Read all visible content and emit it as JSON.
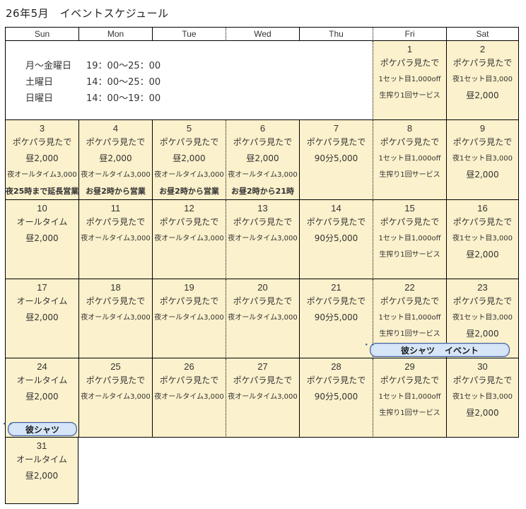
{
  "title": "26年5月　イベントスケジュール",
  "weekdays": [
    "Sun",
    "Mon",
    "Tue",
    "Wed",
    "Thu",
    "Fri",
    "Sat"
  ],
  "hours": [
    {
      "label": "月～金曜日",
      "time": "19：00～25：00"
    },
    {
      "label": "土曜日",
      "time": "14：00～25：00"
    },
    {
      "label": "日曜日",
      "time": "14：00～19：00"
    }
  ],
  "days": [
    {
      "n": "1",
      "lines": [
        "ポケパラ見たで",
        "1セット目1,000off",
        "生搾り1回サービス"
      ]
    },
    {
      "n": "2",
      "lines": [
        "ポケパラ見たで",
        "夜1セット目3,000",
        "昼2,000"
      ]
    },
    {
      "n": "3",
      "lines": [
        "ポケパラ見たで",
        "昼2,000",
        "夜オールタイム3,000",
        "夜25時まで延長営業"
      ]
    },
    {
      "n": "4",
      "lines": [
        "ポケパラ見たで",
        "昼2,000",
        "夜オールタイム3,000",
        "お昼2時から営業"
      ]
    },
    {
      "n": "5",
      "lines": [
        "ポケパラ見たで",
        "昼2,000",
        "夜オールタイム3,000",
        "お昼2時から営業"
      ]
    },
    {
      "n": "6",
      "lines": [
        "ポケパラ見たで",
        "昼2,000",
        "夜オールタイム3,000",
        "お昼2時から21時"
      ]
    },
    {
      "n": "7",
      "lines": [
        "ポケパラ見たで",
        "90分5,000"
      ]
    },
    {
      "n": "8",
      "lines": [
        "ポケパラ見たで",
        "1セット目1,000off",
        "生搾り1回サービス"
      ]
    },
    {
      "n": "9",
      "lines": [
        "ポケパラ見たで",
        "夜1セット目3,000",
        "昼2,000"
      ]
    },
    {
      "n": "10",
      "lines": [
        "オールタイム",
        "昼2,000"
      ]
    },
    {
      "n": "11",
      "lines": [
        "ポケパラ見たで",
        "夜オールタイム3,000"
      ]
    },
    {
      "n": "12",
      "lines": [
        "ポケパラ見たで",
        "夜オールタイム3,000"
      ]
    },
    {
      "n": "13",
      "lines": [
        "ポケパラ見たで",
        "夜オールタイム3,000"
      ]
    },
    {
      "n": "14",
      "lines": [
        "ポケパラ見たで",
        "90分5,000"
      ]
    },
    {
      "n": "15",
      "lines": [
        "ポケパラ見たで",
        "1セット目1,000off",
        "生搾り1回サービス"
      ]
    },
    {
      "n": "16",
      "lines": [
        "ポケパラ見たで",
        "夜1セット目3,000",
        "昼2,000"
      ]
    },
    {
      "n": "17",
      "lines": [
        "オールタイム",
        "昼2,000"
      ]
    },
    {
      "n": "18",
      "lines": [
        "ポケパラ見たで",
        "夜オールタイム3,000"
      ]
    },
    {
      "n": "19",
      "lines": [
        "ポケパラ見たで",
        "夜オールタイム3,000"
      ]
    },
    {
      "n": "20",
      "lines": [
        "ポケパラ見たで",
        "夜オールタイム3,000"
      ]
    },
    {
      "n": "21",
      "lines": [
        "ポケパラ見たで",
        "90分5,000"
      ]
    },
    {
      "n": "22",
      "lines": [
        "ポケパラ見たで",
        "1セット目1,000off",
        "生搾り1回サービス"
      ]
    },
    {
      "n": "23",
      "lines": [
        "ポケパラ見たで",
        "夜1セット目3,000",
        "昼2,000"
      ]
    },
    {
      "n": "24",
      "lines": [
        "オールタイム",
        "昼2,000"
      ]
    },
    {
      "n": "25",
      "lines": [
        "ポケパラ見たで",
        "夜オールタイム3,000"
      ]
    },
    {
      "n": "26",
      "lines": [
        "ポケパラ見たで",
        "夜オールタイム3,000"
      ]
    },
    {
      "n": "27",
      "lines": [
        "ポケパラ見たで",
        "夜オールタイム3,000"
      ]
    },
    {
      "n": "28",
      "lines": [
        "ポケパラ見たで",
        "90分5,000"
      ]
    },
    {
      "n": "29",
      "lines": [
        "ポケパラ見たで",
        "1セット目1,000off",
        "生搾り1回サービス"
      ]
    },
    {
      "n": "30",
      "lines": [
        "ポケパラ見たで",
        "夜1セット目3,000",
        "昼2,000"
      ]
    },
    {
      "n": "31",
      "lines": [
        "オールタイム",
        "昼2,000"
      ]
    }
  ],
  "events": [
    {
      "day": "22",
      "text": [
        "彼シャツ",
        "イベント"
      ]
    },
    {
      "day": "24",
      "text": [
        "彼シャツ"
      ]
    }
  ],
  "colors": {
    "cell_bg": "#fbf1cc",
    "event_bg": "#d6e6f8",
    "event_border": "#3a5a9a"
  }
}
